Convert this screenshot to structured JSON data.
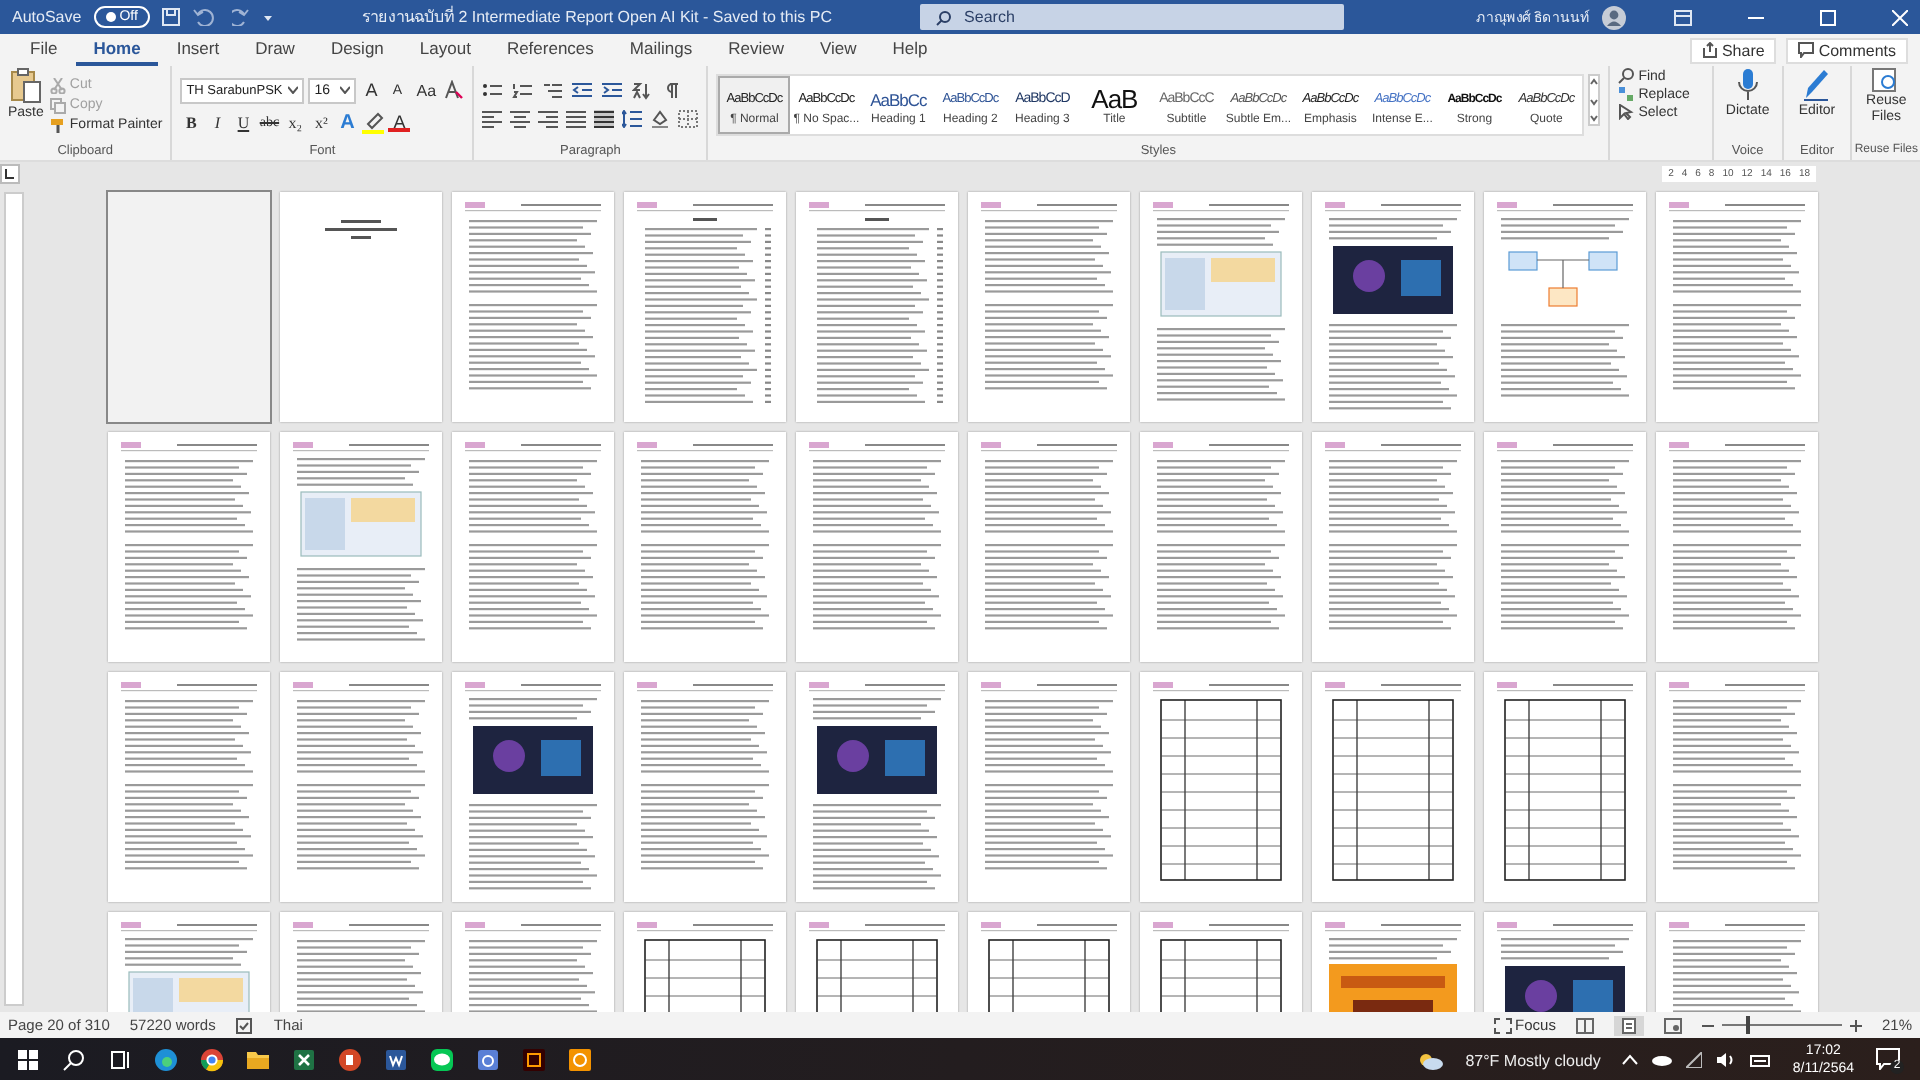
{
  "title_bar": {
    "autosave_label": "AutoSave",
    "autosave_toggle": {
      "label": "Off",
      "on": false
    },
    "title": "รายงานฉบับที่ 2 Intermediate Report Open AI Kit  -  Saved to this PC",
    "search": {
      "placeholder": "Search"
    },
    "user_name": "ภาณุพงศ์ ธิดานนท์"
  },
  "menu_tabs": [
    {
      "label": "File",
      "selected": false
    },
    {
      "label": "Home",
      "selected": true
    },
    {
      "label": "Insert",
      "selected": false
    },
    {
      "label": "Draw",
      "selected": false
    },
    {
      "label": "Design",
      "selected": false
    },
    {
      "label": "Layout",
      "selected": false
    },
    {
      "label": "References",
      "selected": false
    },
    {
      "label": "Mailings",
      "selected": false
    },
    {
      "label": "Review",
      "selected": false
    },
    {
      "label": "View",
      "selected": false
    },
    {
      "label": "Help",
      "selected": false
    }
  ],
  "share_button": "Share",
  "comments_button": "Comments",
  "ribbon": {
    "clipboard": {
      "paste": "Paste",
      "cut": {
        "label": "Cut",
        "disabled": true
      },
      "copy": {
        "label": "Copy",
        "disabled": true
      },
      "format_painter": "Format Painter",
      "group": "Clipboard"
    },
    "font": {
      "name": "TH SarabunPSK",
      "size": "16",
      "grow": "A",
      "shrink": "A",
      "change_case": "Aa",
      "format_buttons": [
        {
          "label": "B",
          "kind": "bold"
        },
        {
          "label": "I",
          "kind": "italic"
        },
        {
          "label": "U",
          "kind": "underline"
        },
        {
          "label": "abc",
          "kind": "strike"
        },
        {
          "label": "x₂",
          "kind": "sub"
        },
        {
          "label": "x²",
          "kind": "sup"
        }
      ],
      "text_effects": "A",
      "font_color": "A",
      "group": "Font"
    },
    "paragraph": {
      "group": "Paragraph"
    },
    "styles": {
      "items": [
        {
          "preview": "AaBbCcDc",
          "name": "¶ Normal",
          "kind": "normal",
          "selected": true
        },
        {
          "preview": "AaBbCcDc",
          "name": "¶ No Spac...",
          "kind": "normal",
          "selected": false
        },
        {
          "preview": "AaBbCc",
          "name": "Heading 1",
          "kind": "heading1",
          "selected": false
        },
        {
          "preview": "AaBbCcDc",
          "name": "Heading 2",
          "kind": "heading2",
          "selected": false
        },
        {
          "preview": "AaBbCcD",
          "name": "Heading 3",
          "kind": "heading3",
          "selected": false
        },
        {
          "preview": "AaB",
          "name": "Title",
          "kind": "title",
          "selected": false
        },
        {
          "preview": "AaBbCcC",
          "name": "Subtitle",
          "kind": "subtitle",
          "selected": false
        },
        {
          "preview": "AaBbCcDc",
          "name": "Subtle Em...",
          "kind": "subtle",
          "selected": false
        },
        {
          "preview": "AaBbCcDc",
          "name": "Emphasis",
          "kind": "emphasis",
          "selected": false
        },
        {
          "preview": "AaBbCcDc",
          "name": "Intense E...",
          "kind": "intense",
          "selected": false
        },
        {
          "preview": "AaBbCcDc",
          "name": "Strong",
          "kind": "strong",
          "selected": false
        },
        {
          "preview": "AaBbCcDc",
          "name": "Quote",
          "kind": "quote",
          "selected": false
        }
      ],
      "group": "Styles"
    },
    "editing": [
      {
        "label": "Find",
        "kind": "find"
      },
      {
        "label": "Replace",
        "kind": "replace"
      },
      {
        "label": "Select",
        "kind": "select"
      }
    ],
    "voice": {
      "button": "Dictate",
      "group": "Voice"
    },
    "editor": {
      "button": "Editor",
      "group": "Editor"
    },
    "reuse": {
      "button": "Reuse Files",
      "group": "Reuse Files"
    }
  },
  "ruler_marks": [
    "2",
    "4",
    "6",
    "8",
    "10",
    "12",
    "14",
    "16",
    "18"
  ],
  "status_bar": {
    "page": "Page 20 of 310",
    "words": "57220 words",
    "language": "Thai",
    "focus": "Focus",
    "zoom": "21%",
    "zoom_slider": {
      "level": 0.2
    }
  },
  "taskbar": {
    "weather": "87°F  Mostly cloudy",
    "time": "17:02",
    "date": "8/11/2564",
    "notifications": "2"
  }
}
